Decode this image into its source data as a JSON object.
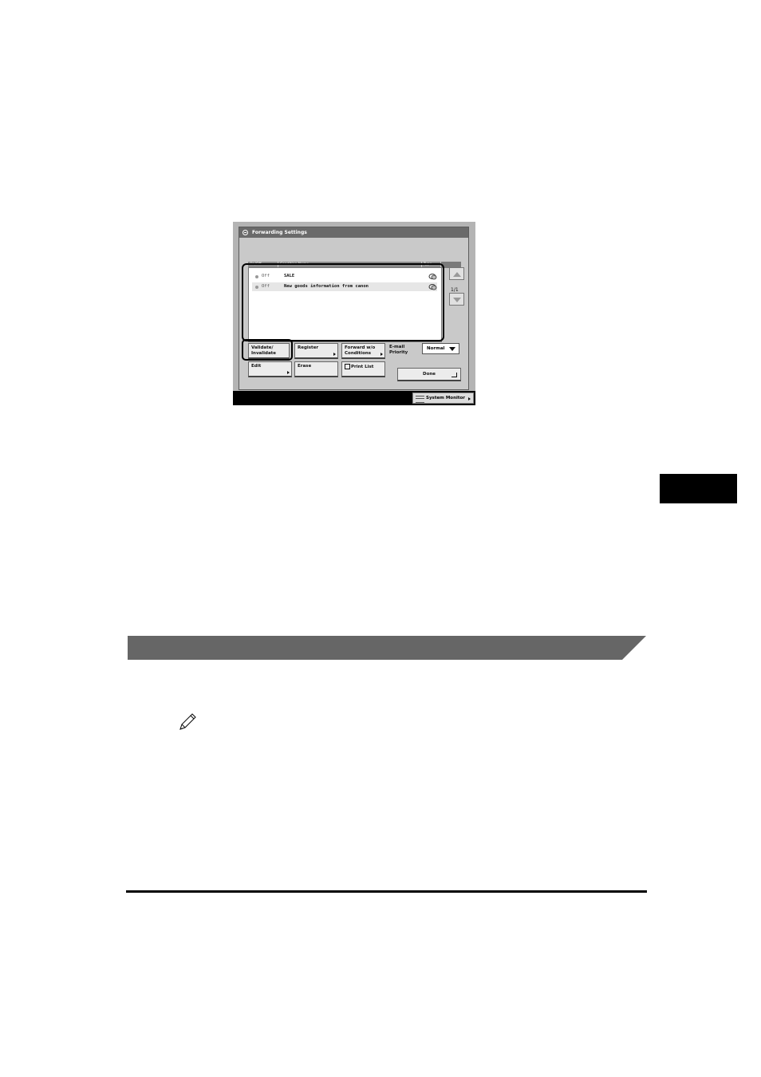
{
  "screen": {
    "title": "Forwarding Settings",
    "columns": {
      "on_off": "On/Off",
      "condition_name": "Condition Name",
      "type": "Type"
    },
    "rows": [
      {
        "status": "Off",
        "name": "SALE",
        "type_icon": "email-icon"
      },
      {
        "status": "Off",
        "name": "New goods information from canon",
        "type_icon": "email-icon"
      }
    ],
    "page_indicator": "1/1",
    "buttons": {
      "validate_line1": "Validate/",
      "validate_line2": "Invalidate",
      "register": "Register",
      "forward_line1": "Forward w/o",
      "forward_line2": "Conditions",
      "edit": "Edit",
      "erase": "Erase",
      "print_list": "Print List",
      "done": "Done"
    },
    "email_priority_line1": "E-mail",
    "email_priority_line2": "Priority",
    "email_priority_value": "Normal",
    "system_monitor": "System Monitor"
  },
  "colors": {
    "band": "#666666",
    "side_tab": "#000000",
    "rule": "#000000"
  },
  "icons": {
    "note": "pencil-note-icon"
  }
}
